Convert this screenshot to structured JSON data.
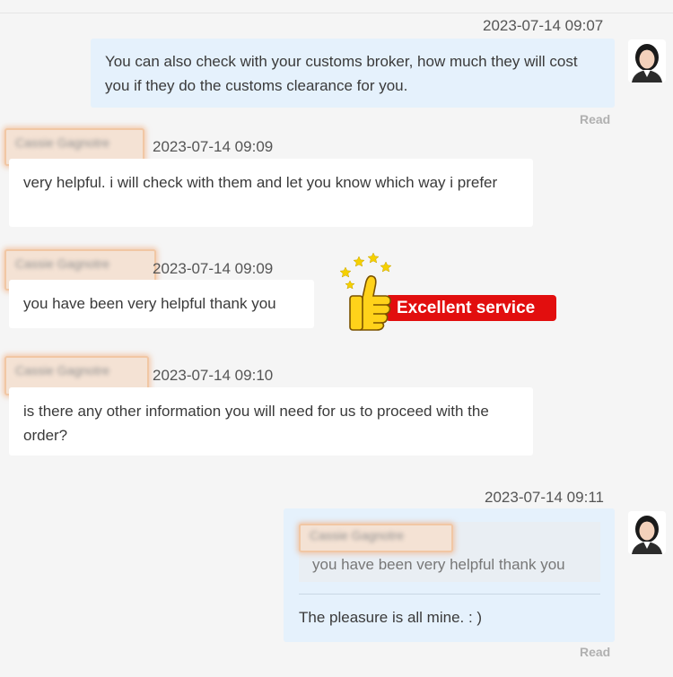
{
  "messages": [
    {
      "timestamp": "2023-07-14 09:07",
      "text": "You can also check with your customs broker, how much they will cost you if they do the customs clearance for you.",
      "status": "Read"
    },
    {
      "sender": "Cassie Gagnotre",
      "timestamp": "2023-07-14 09:09",
      "text": "very helpful. i will check with them and let you know which way i prefer"
    },
    {
      "sender": "Cassie Gagnotre",
      "timestamp": "2023-07-14 09:09",
      "text": "you have been very helpful thank you"
    },
    {
      "sender": "Cassie Gagnotre",
      "timestamp": "2023-07-14 09:10",
      "text": "is there any other information you will need for us to proceed with the order?"
    },
    {
      "timestamp": "2023-07-14 09:11",
      "quote_sender": "Cassie Gagnotre",
      "quote_text": "you have been very helpful thank you",
      "text": "The pleasure is all mine. : )",
      "status": "Read"
    }
  ],
  "badge": {
    "label": "Excellent service"
  },
  "colors": {
    "background": "#f5f5f5",
    "outgoing_bubble": "#e5f1fc",
    "incoming_bubble": "#ffffff",
    "badge": "#e20e0e",
    "star": "#f5d000"
  },
  "icons": [
    "agent-avatar",
    "thumbs-up-icon",
    "star-icon"
  ]
}
